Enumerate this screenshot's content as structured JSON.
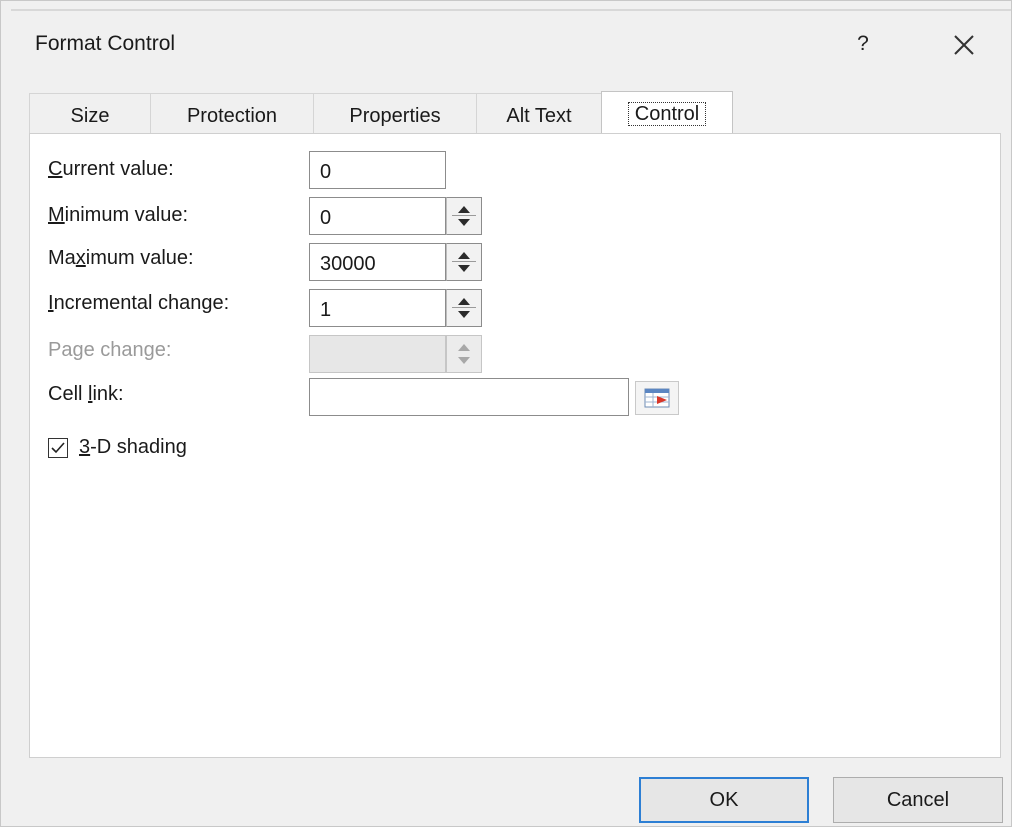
{
  "dialog": {
    "title": "Format Control",
    "help_label": "?"
  },
  "tabs": [
    {
      "label": "Size",
      "active": false
    },
    {
      "label": "Protection",
      "active": false
    },
    {
      "label": "Properties",
      "active": false
    },
    {
      "label": "Alt Text",
      "active": false
    },
    {
      "label": "Control",
      "active": true
    }
  ],
  "control": {
    "current_value": {
      "label_u": "C",
      "label_rest": "urrent value:",
      "value": "0"
    },
    "minimum_value": {
      "label_u": "M",
      "label_rest": "inimum value:",
      "value": "0"
    },
    "maximum_value": {
      "label_pre": "Ma",
      "label_u": "x",
      "label_rest": "imum value:",
      "value": "30000"
    },
    "incremental_change": {
      "label_u": "I",
      "label_rest": "ncremental change:",
      "value": "1"
    },
    "page_change": {
      "label": "Page change:",
      "value": "",
      "disabled": true
    },
    "cell_link": {
      "label_pre": "Cell ",
      "label_u": "l",
      "label_rest": "ink:",
      "value": ""
    },
    "shading": {
      "label_u": "3",
      "label_rest": "-D shading",
      "checked": true
    }
  },
  "buttons": {
    "ok": "OK",
    "cancel": "Cancel"
  },
  "icons": {
    "close": "close-icon",
    "spin": "spinner-arrows-icon",
    "range_picker": "collapse-dialog-icon",
    "check": "checkmark-icon"
  },
  "colors": {
    "default_button_border": "#2d7fd4",
    "disabled_text": "#9a9a9a"
  }
}
